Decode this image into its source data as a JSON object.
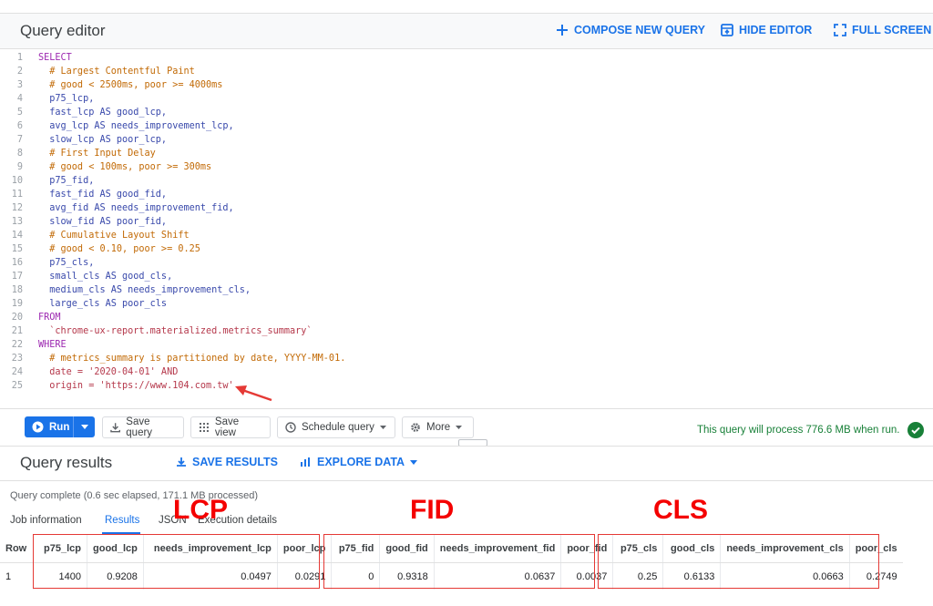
{
  "editor": {
    "title": "Query editor",
    "compose_label": "COMPOSE NEW QUERY",
    "hide_label": "HIDE EDITOR",
    "fullscreen_label": "FULL SCREEN",
    "lines": [
      {
        "n": "1",
        "t": "SELECT",
        "c": "kw"
      },
      {
        "n": "2",
        "t": "  # Largest Contentful Paint",
        "c": "cm"
      },
      {
        "n": "3",
        "t": "  # good < 2500ms, poor >= 4000ms",
        "c": "cm"
      },
      {
        "n": "4",
        "t": "  p75_lcp,",
        "c": "id"
      },
      {
        "n": "5",
        "t": "  fast_lcp AS good_lcp,",
        "c": "id"
      },
      {
        "n": "6",
        "t": "  avg_lcp AS needs_improvement_lcp,",
        "c": "id"
      },
      {
        "n": "7",
        "t": "  slow_lcp AS poor_lcp,",
        "c": "id"
      },
      {
        "n": "8",
        "t": "  # First Input Delay",
        "c": "cm"
      },
      {
        "n": "9",
        "t": "  # good < 100ms, poor >= 300ms",
        "c": "cm"
      },
      {
        "n": "10",
        "t": "  p75_fid,",
        "c": "id"
      },
      {
        "n": "11",
        "t": "  fast_fid AS good_fid,",
        "c": "id"
      },
      {
        "n": "12",
        "t": "  avg_fid AS needs_improvement_fid,",
        "c": "id"
      },
      {
        "n": "13",
        "t": "  slow_fid AS poor_fid,",
        "c": "id"
      },
      {
        "n": "14",
        "t": "  # Cumulative Layout Shift",
        "c": "cm"
      },
      {
        "n": "15",
        "t": "  # good < 0.10, poor >= 0.25",
        "c": "cm"
      },
      {
        "n": "16",
        "t": "  p75_cls,",
        "c": "id"
      },
      {
        "n": "17",
        "t": "  small_cls AS good_cls,",
        "c": "id"
      },
      {
        "n": "18",
        "t": "  medium_cls AS needs_improvement_cls,",
        "c": "id"
      },
      {
        "n": "19",
        "t": "  large_cls AS poor_cls",
        "c": "id"
      },
      {
        "n": "20",
        "t": "FROM",
        "c": "kw"
      },
      {
        "n": "21",
        "t": "  `chrome-ux-report.materialized.metrics_summary`",
        "c": "st"
      },
      {
        "n": "22",
        "t": "WHERE",
        "c": "kw"
      },
      {
        "n": "23",
        "t": "  # metrics_summary is partitioned by date, YYYY-MM-01.",
        "c": "cm"
      },
      {
        "n": "24",
        "t": "  date = '2020-04-01' AND",
        "c": "st"
      },
      {
        "n": "25",
        "t": "  origin = 'https://www.104.com.tw'",
        "c": "st"
      }
    ]
  },
  "toolbar": {
    "run_label": "Run",
    "save_query_label": "Save query",
    "save_view_label": "Save view",
    "schedule_label": "Schedule query",
    "more_label": "More",
    "process_message": "This query will process 776.6 MB when run."
  },
  "results": {
    "title": "Query results",
    "save_label": "SAVE RESULTS",
    "explore_label": "EXPLORE DATA",
    "status": "Query complete (0.6 sec elapsed, 171.1 MB processed)",
    "tabs": [
      "Job information",
      "Results",
      "JSON",
      "Execution details"
    ],
    "active_tab": "Results",
    "columns": [
      "Row",
      "p75_lcp",
      "good_lcp",
      "needs_improvement_lcp",
      "poor_lcp",
      "p75_fid",
      "good_fid",
      "needs_improvement_fid",
      "poor_fid",
      "p75_cls",
      "good_cls",
      "needs_improvement_cls",
      "poor_cls"
    ],
    "rows": [
      [
        "1",
        "1400",
        "0.9208",
        "0.0497",
        "0.0291",
        "0",
        "0.9318",
        "0.0637",
        "0.0037",
        "0.25",
        "0.6133",
        "0.0663",
        "0.2749"
      ]
    ]
  },
  "annotations": {
    "lcp": "LCP",
    "fid": "FID",
    "cls": "CLS",
    "color": "#f40000"
  },
  "colors": {
    "accent": "#1a73e8",
    "success": "#188038"
  }
}
